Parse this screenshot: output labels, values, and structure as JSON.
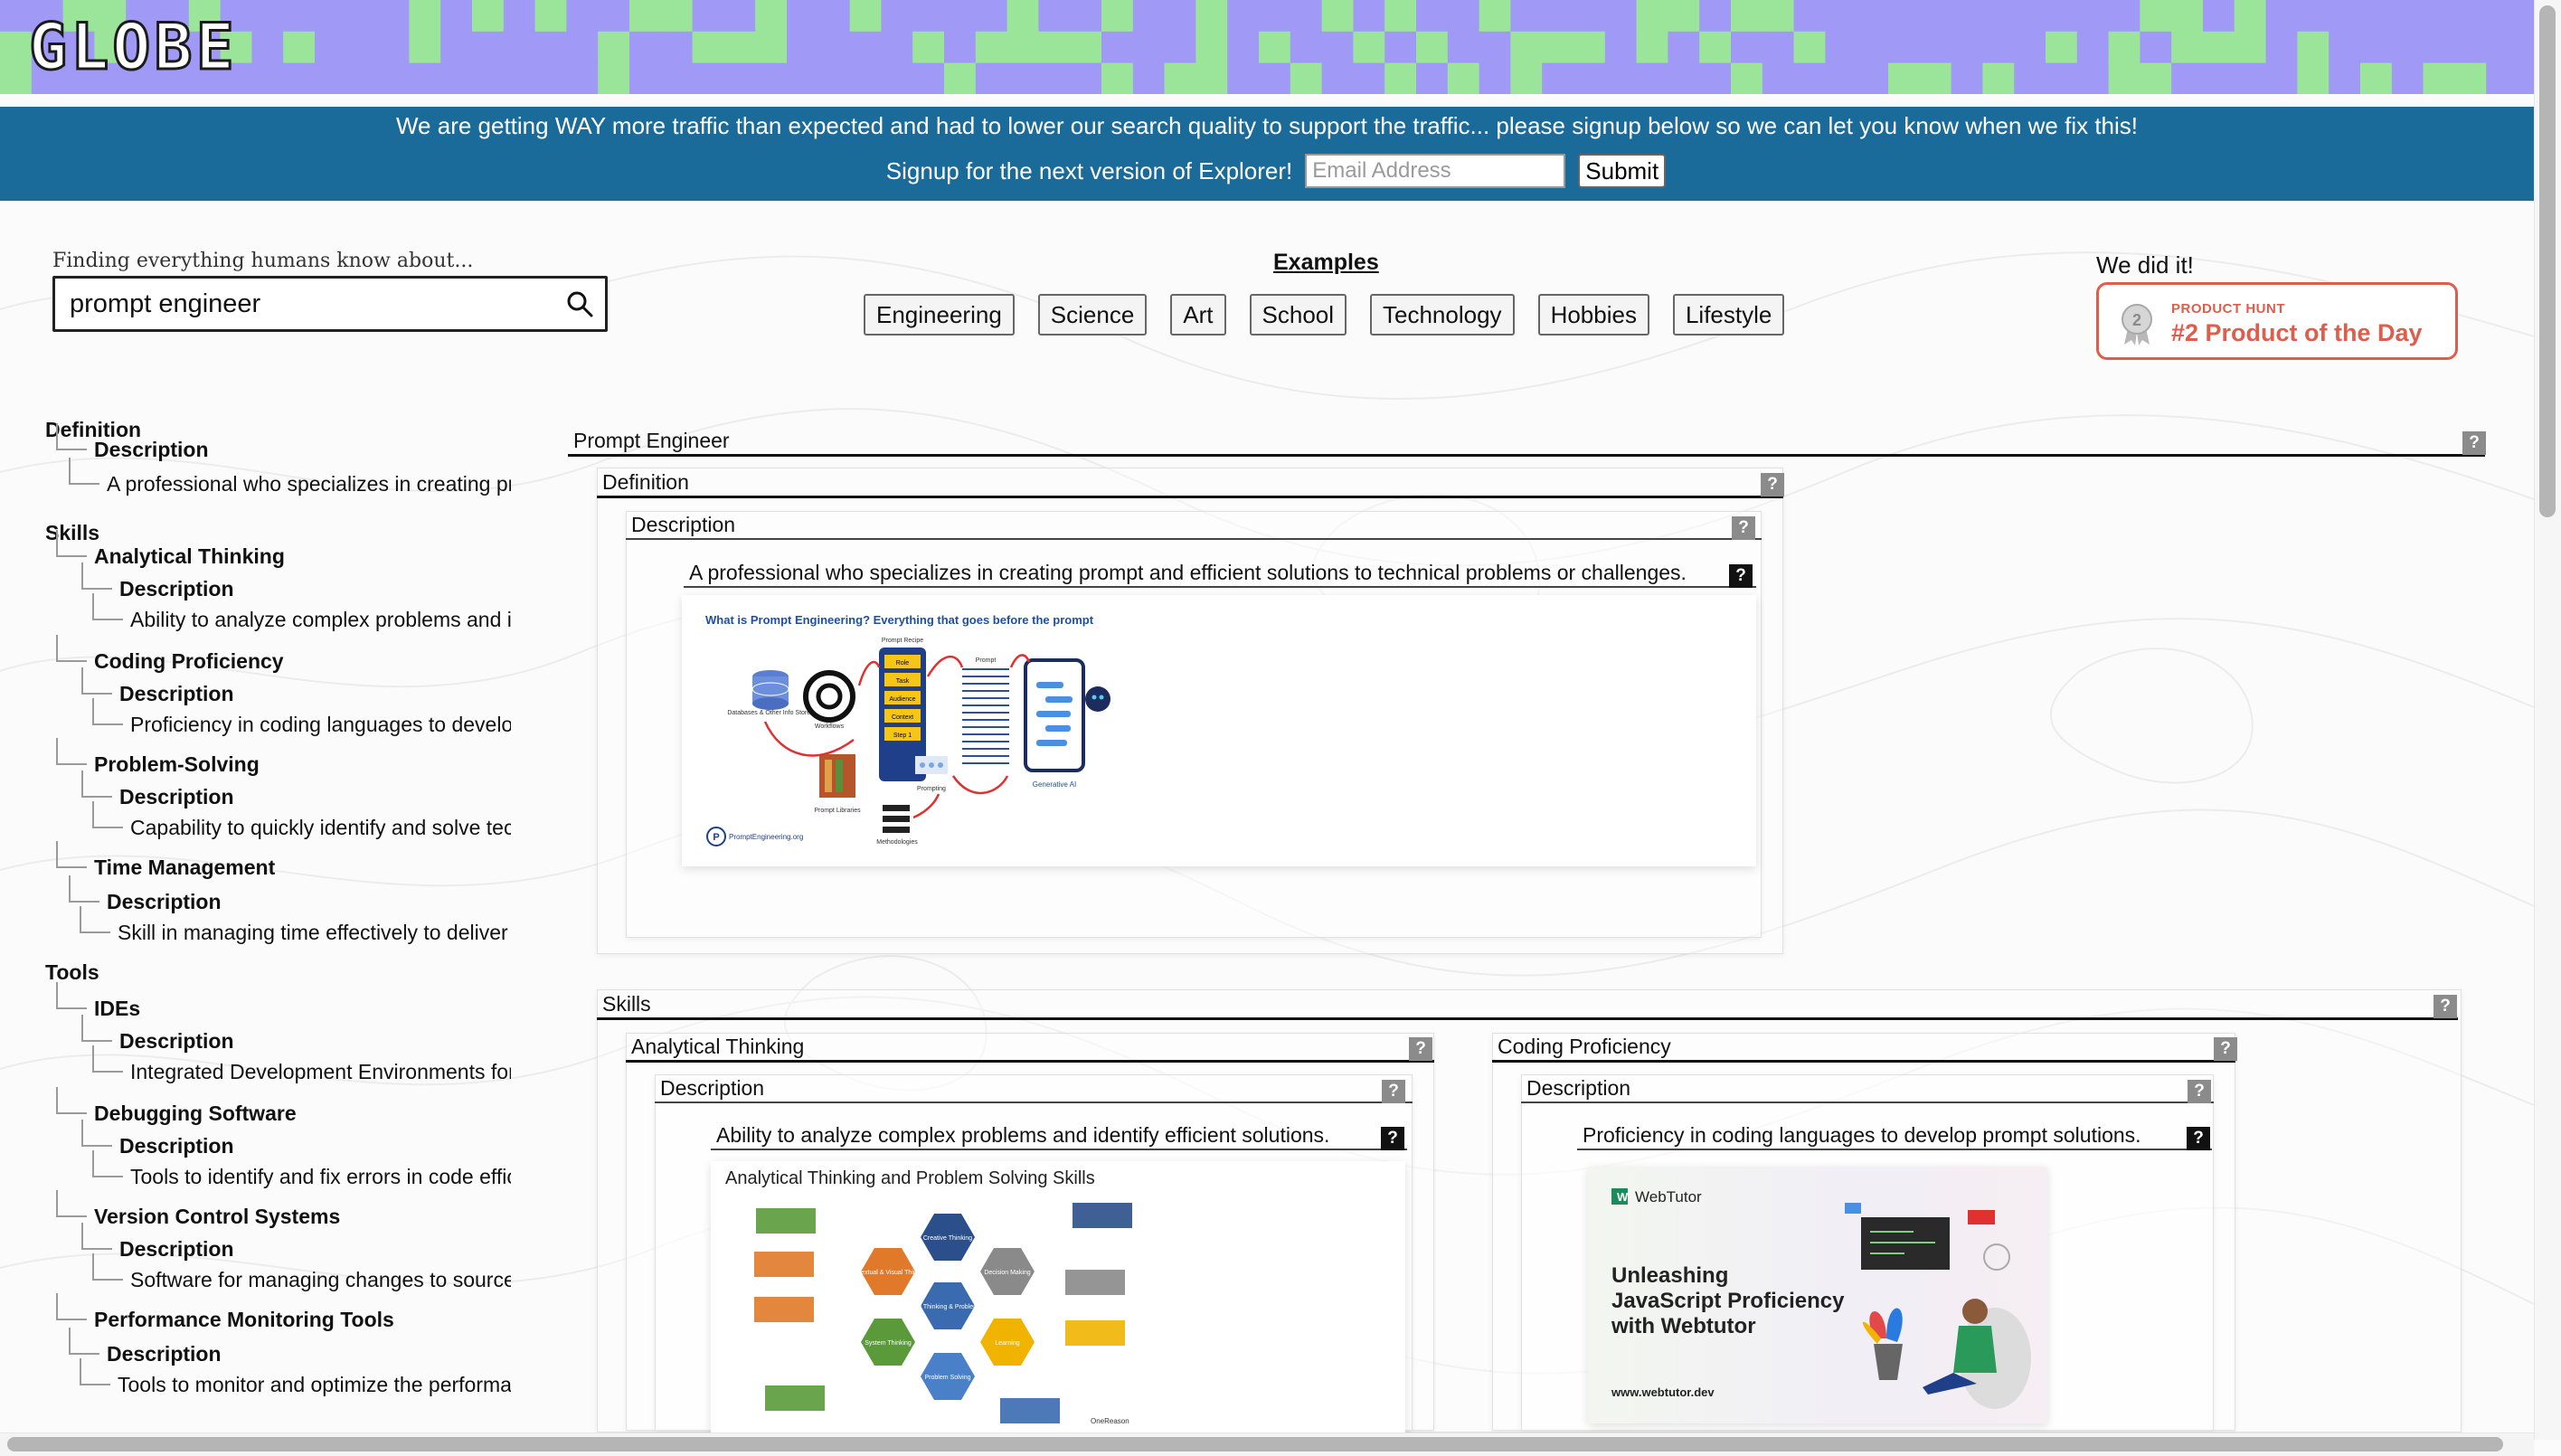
{
  "header": {
    "logo_text": "GLOBE",
    "mosaic_colors": [
      "#a09af6",
      "#9be59b"
    ]
  },
  "banner": {
    "message": "We are getting WAY more traffic than expected and had to lower our search quality to support the traffic... please signup below so we can let you know when we fix this!",
    "signup_label": "Signup for the next version of Explorer!",
    "email_placeholder": "Email Address",
    "submit_label": "Submit",
    "color": "#1a6a9a"
  },
  "search": {
    "caption": "Finding everything humans know about...",
    "value": "prompt engineer"
  },
  "examples": {
    "title": "Examples",
    "chips": [
      "Engineering",
      "Science",
      "Art",
      "School",
      "Technology",
      "Hobbies",
      "Lifestyle"
    ]
  },
  "product_hunt": {
    "heading": "We did it!",
    "small": "PRODUCT HUNT",
    "big": "#2 Product of the Day",
    "medal_number": "2",
    "color": "#de5e4e"
  },
  "tree": [
    {
      "text": "Definition",
      "bold": true
    },
    {
      "text": "Description",
      "bold": true
    },
    {
      "text": "A professional who specializes in creating prompt and efficient solutions to technical problems or challenges.",
      "bold": false
    },
    {
      "text": "Skills",
      "bold": true
    },
    {
      "text": "Analytical Thinking",
      "bold": true
    },
    {
      "text": "Description",
      "bold": true
    },
    {
      "text": "Ability to analyze complex problems and identify efficient solutions.",
      "bold": false
    },
    {
      "text": "Coding Proficiency",
      "bold": true
    },
    {
      "text": "Description",
      "bold": true
    },
    {
      "text": "Proficiency in coding languages to develop prompt solutions.",
      "bold": false
    },
    {
      "text": "Problem-Solving",
      "bold": true
    },
    {
      "text": "Description",
      "bold": true
    },
    {
      "text": "Capability to quickly identify and solve technical issues.",
      "bold": false
    },
    {
      "text": "Time Management",
      "bold": true
    },
    {
      "text": "Description",
      "bold": true
    },
    {
      "text": "Skill in managing time effectively to deliver prompt solutions.",
      "bold": false
    },
    {
      "text": "Tools",
      "bold": true
    },
    {
      "text": "IDEs",
      "bold": true
    },
    {
      "text": "Description",
      "bold": true
    },
    {
      "text": "Integrated Development Environments for coding.",
      "bold": false
    },
    {
      "text": "Debugging Software",
      "bold": true
    },
    {
      "text": "Description",
      "bold": true
    },
    {
      "text": "Tools to identify and fix errors in code efficiently.",
      "bold": false
    },
    {
      "text": "Version Control Systems",
      "bold": true
    },
    {
      "text": "Description",
      "bold": true
    },
    {
      "text": "Software for managing changes to source code.",
      "bold": false
    },
    {
      "text": "Performance Monitoring Tools",
      "bold": true
    },
    {
      "text": "Description",
      "bold": true
    },
    {
      "text": "Tools to monitor and optimize the performance of solutions.",
      "bold": false
    }
  ],
  "main": {
    "root_title": "Prompt Engineer",
    "help_label": "?",
    "definition": {
      "title": "Definition",
      "description_title": "Description",
      "text": "A professional who specializes in creating prompt and efficient solutions to technical problems or challenges.",
      "image": {
        "title": "What is Prompt Engineering? Everything that goes before the prompt",
        "labels": [
          "Prompt Recipe",
          "Prompt",
          "Databases & Other Info Stores",
          "Workflows",
          "Prompting",
          "Generative AI",
          "Prompt Libraries",
          "Methodologies",
          "PromptEngineering.org"
        ],
        "recipe_rows": [
          "Role",
          "Task",
          "Audience",
          "Context",
          "Step 1"
        ]
      }
    },
    "skills": {
      "title": "Skills",
      "analytical": {
        "title": "Analytical Thinking",
        "description_title": "Description",
        "text": "Ability to analyze complex problems and identify efficient solutions.",
        "image_title": "Analytical Thinking and Problem Solving Skills",
        "hex_labels": [
          "Creative Thinking",
          "Contextual & Visual Thinking",
          "Decision Making",
          "Analytical Thinking & Problem Solving",
          "System Thinking",
          "Learning",
          "Problem Solving"
        ],
        "footer": "OneReason"
      },
      "coding": {
        "title": "Coding Proficiency",
        "description_title": "Description",
        "text": "Proficiency in coding languages to develop prompt solutions.",
        "image": {
          "brand": "WebTutor",
          "headline_1": "Unleashing",
          "headline_2": "JavaScript Proficiency",
          "headline_3": "with Webtutor",
          "url": "www.webtutor.dev"
        }
      }
    }
  }
}
